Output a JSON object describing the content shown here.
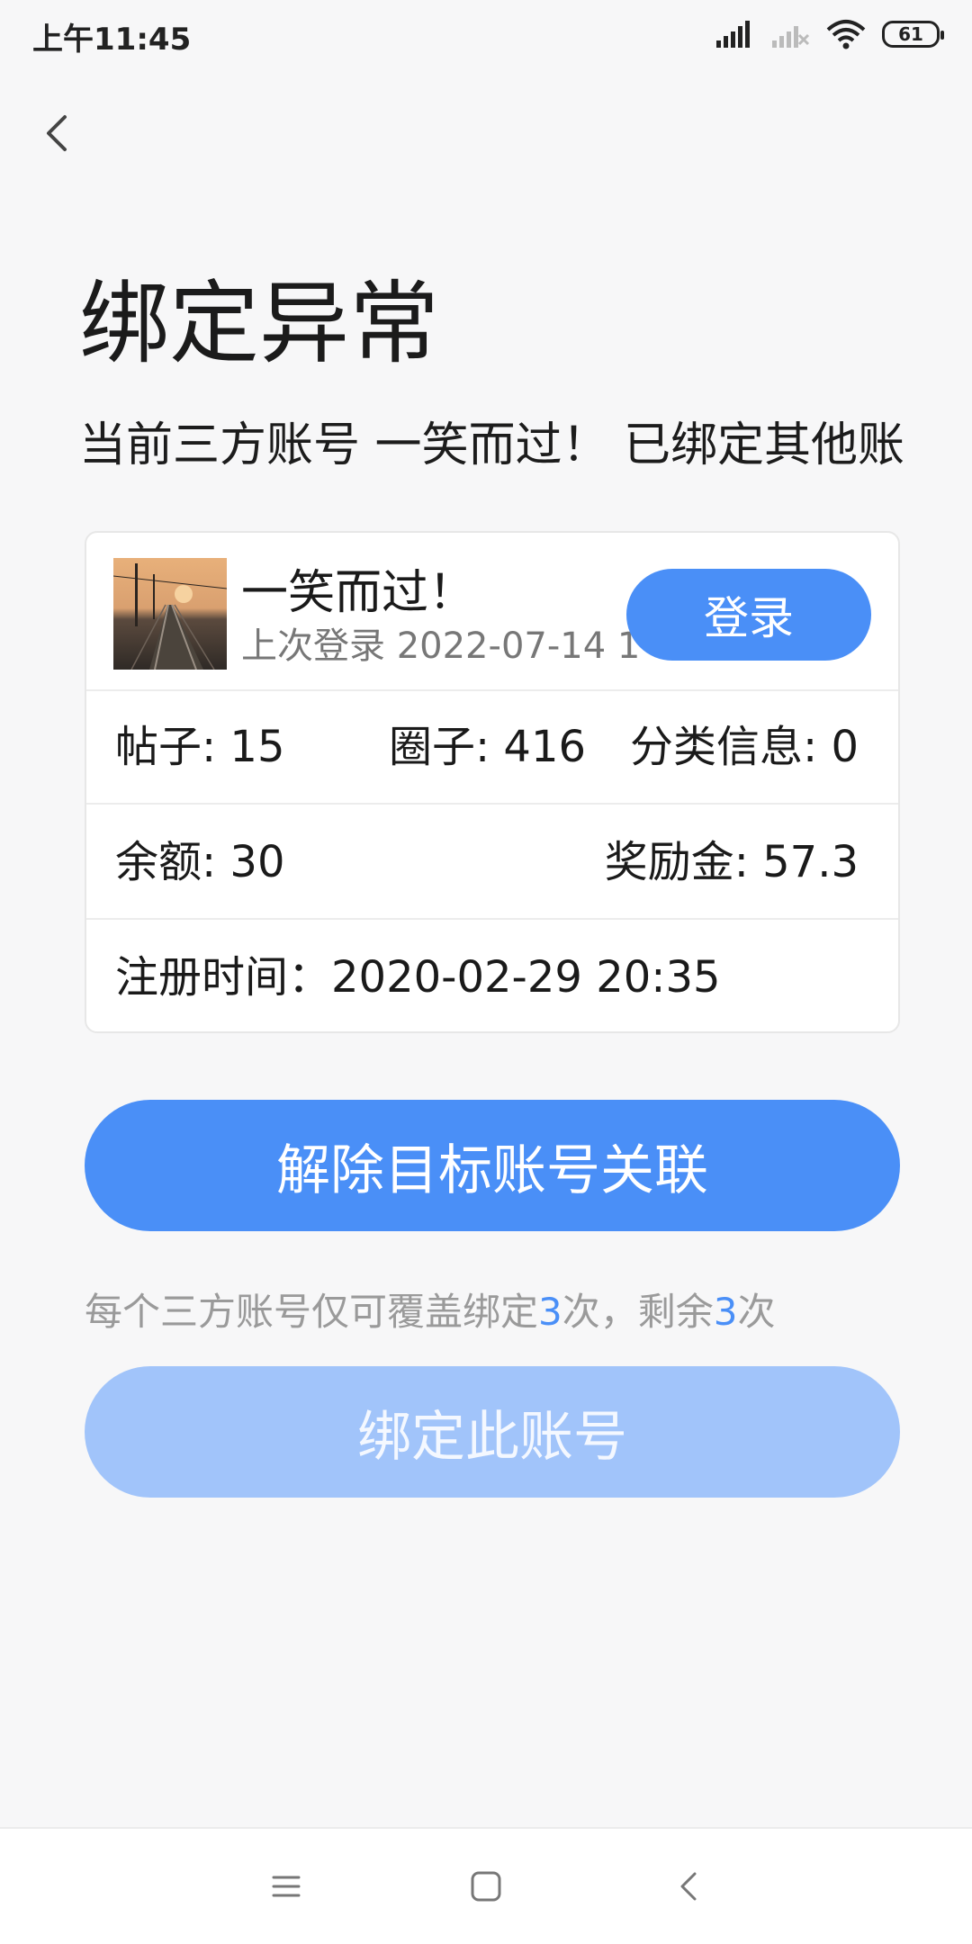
{
  "status_bar": {
    "time": "上午11:45",
    "battery": "61",
    "icons": [
      "signal-icon",
      "signal-icon",
      "wifi-icon",
      "battery-icon"
    ]
  },
  "header": {
    "back_icon": "back-icon",
    "title": "绑定异常",
    "subtitle": "当前三方账号  一笑而过！ 已绑定其他账"
  },
  "account_card": {
    "name": "一笑而过！",
    "last_login": "上次登录 2022-07-14 1",
    "login_button": "登录",
    "posts": "帖子: 15",
    "circles": "圈子: 416",
    "classifieds": "分类信息: 0",
    "balance": "余额: 30",
    "bonus": "奖励金: 57.3",
    "registered": "注册时间：2020-02-29 20:35"
  },
  "actions": {
    "unlink_button": "解除目标账号关联",
    "hint_prefix": "每个三方账号仅可覆盖绑定",
    "hint_total": "3",
    "hint_middle": "次，剩余",
    "hint_remaining": "3",
    "hint_suffix": "次",
    "bind_button": "绑定此账号"
  },
  "nav_bar": {
    "icons": [
      "menu-icon",
      "home-icon",
      "back-icon"
    ]
  },
  "colors": {
    "accent": "#4a8ff7",
    "accent_light": "#a1c4fa",
    "background": "#f7f7f8"
  }
}
